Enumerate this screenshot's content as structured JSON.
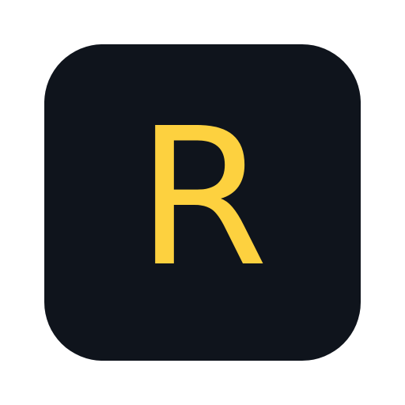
{
  "icon": {
    "letter": "R",
    "background_color": "#0f141c",
    "letter_color": "#fdd13f",
    "page_background": "#ffffff"
  }
}
